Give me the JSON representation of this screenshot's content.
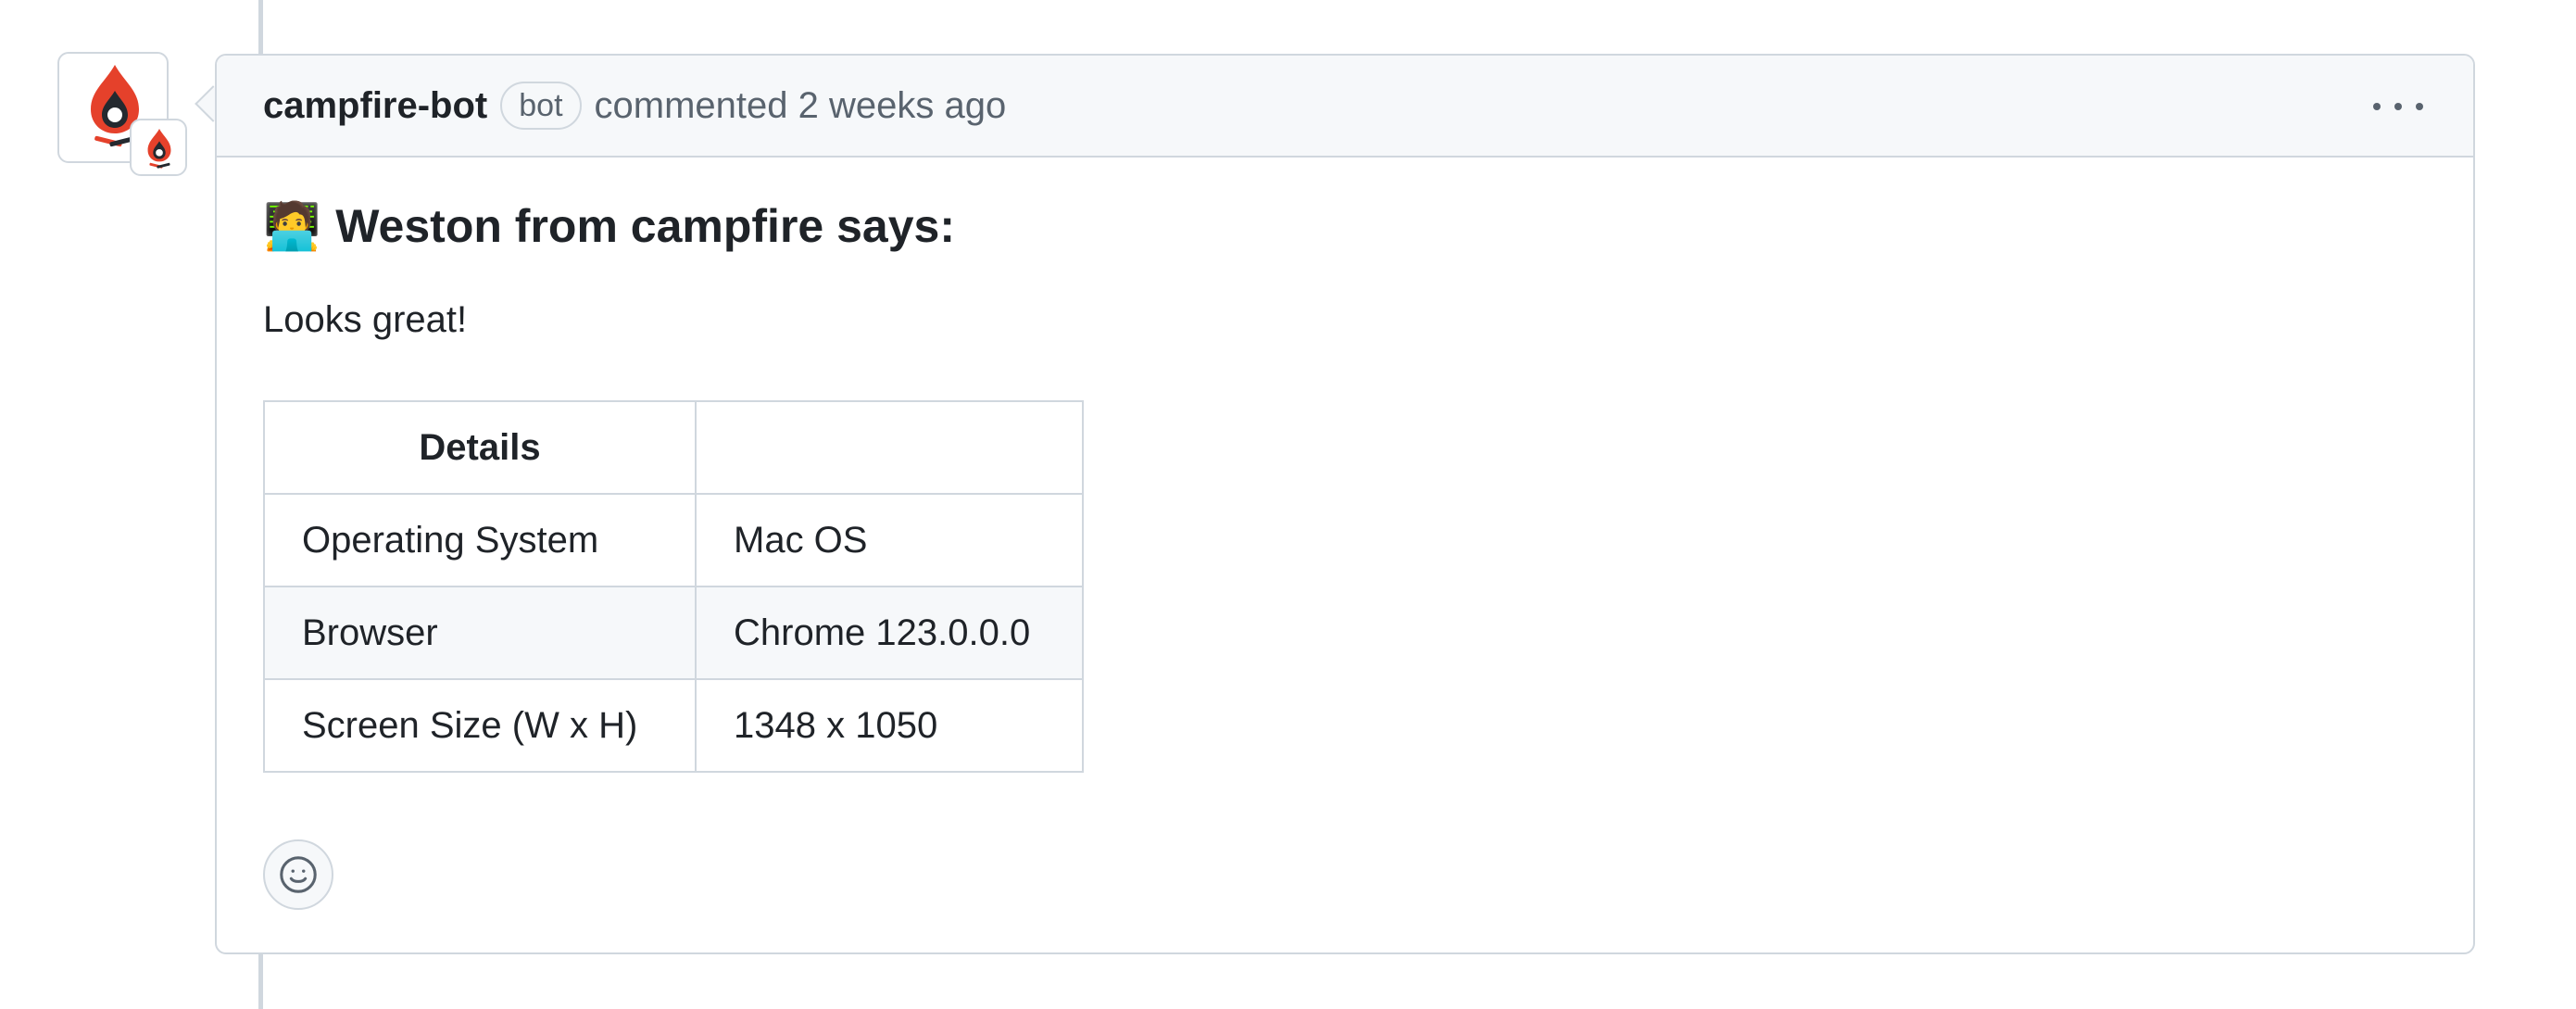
{
  "comment": {
    "author": "campfire-bot",
    "badge": "bot",
    "action": "commented",
    "time": "2 weeks ago",
    "heading_emoji": "🧑‍💻",
    "heading_text": "Weston from campfire says:",
    "message": "Looks great!",
    "table": {
      "header": [
        "Details",
        ""
      ],
      "rows": [
        [
          "Operating System",
          "Mac OS"
        ],
        [
          "Browser",
          "Chrome 123.0.0.0"
        ],
        [
          "Screen Size (W x H)",
          "1348 x 1050"
        ]
      ]
    }
  },
  "icons": {
    "avatar": "campfire-logo-icon",
    "badge": "campfire-app-badge-icon",
    "menu": "kebab-horizontal-icon",
    "reaction": "smiley-icon"
  },
  "colors": {
    "border": "#d0d7de",
    "header_bg": "#f6f8fa",
    "muted_text": "#59636e",
    "logo_red": "#e5412b",
    "logo_dark": "#24292f"
  }
}
